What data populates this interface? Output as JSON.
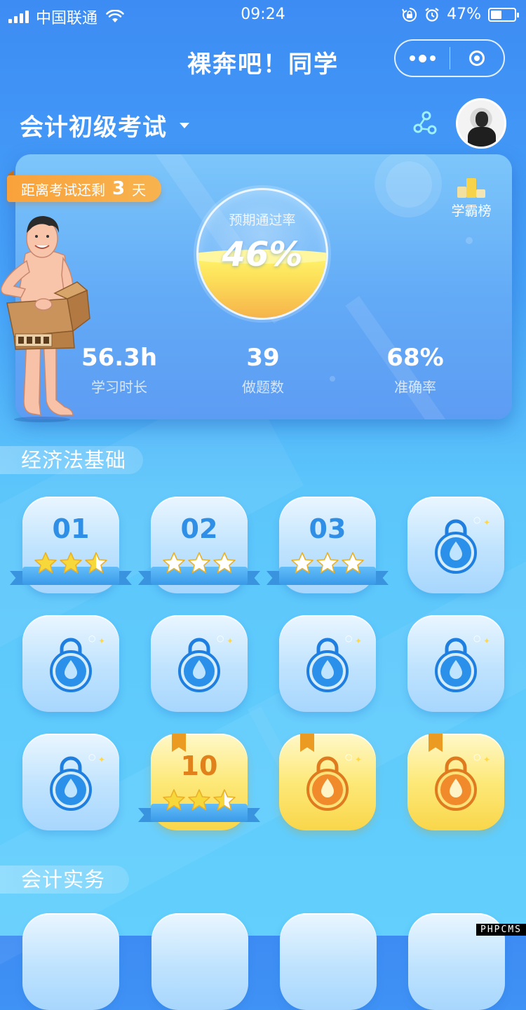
{
  "status_bar": {
    "carrier": "中国联通",
    "time": "09:24",
    "battery_text": "47%",
    "battery_level": 0.47
  },
  "nav": {
    "title": "裸奔吧！同学"
  },
  "exam": {
    "name": "会计初级考试"
  },
  "stats": {
    "countdown_prefix": "距离考试还剩",
    "countdown_days": "3",
    "countdown_suffix": "天",
    "ranking_label": "学霸榜",
    "pass_rate_label": "预期通过率",
    "pass_rate_value": "46%",
    "pass_rate_fraction": 0.46,
    "study_time_value": "56.3h",
    "study_time_label": "学习时长",
    "questions_value": "39",
    "questions_label": "做题数",
    "accuracy_value": "68%",
    "accuracy_label": "准确率"
  },
  "sections": [
    {
      "title": "经济法基础",
      "levels": [
        {
          "number": "01",
          "state": "unlocked",
          "stars": 2.5
        },
        {
          "number": "02",
          "state": "unlocked",
          "stars": 0
        },
        {
          "number": "03",
          "state": "unlocked",
          "stars": 0
        },
        {
          "number": "",
          "state": "locked",
          "stars": 0
        },
        {
          "number": "",
          "state": "locked",
          "stars": 0
        },
        {
          "number": "",
          "state": "locked",
          "stars": 0
        },
        {
          "number": "",
          "state": "locked",
          "stars": 0
        },
        {
          "number": "",
          "state": "locked",
          "stars": 0
        },
        {
          "number": "",
          "state": "locked",
          "stars": 0
        },
        {
          "number": "10",
          "state": "gold",
          "stars": 2.5
        },
        {
          "number": "",
          "state": "gold-locked",
          "stars": 0
        },
        {
          "number": "",
          "state": "gold-locked",
          "stars": 0
        }
      ]
    },
    {
      "title": "会计实务",
      "levels": []
    }
  ],
  "watermark": "PHPCMS",
  "colors": {
    "primary_blue": "#3d8cf4",
    "level_blue": "#2f8fe6",
    "gold": "#f9d64a",
    "countdown_orange": "#f9a23b",
    "star_yellow": "#f7d83a"
  }
}
